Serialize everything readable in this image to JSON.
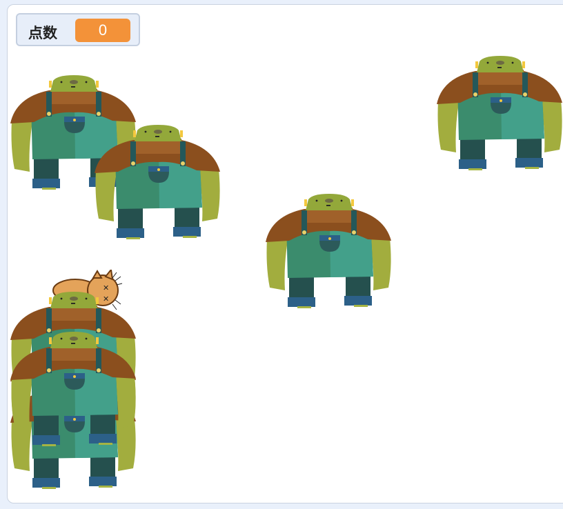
{
  "score": {
    "label": "点数",
    "value": "0"
  },
  "colors": {
    "stage_bg": "#ffffff",
    "score_value_bg": "#f39239",
    "ogre_skin": "#93a83a",
    "ogre_overalls": "#3b8c6d",
    "ogre_shoulder": "#8b4f1e",
    "cat_orange": "#e4a35a"
  },
  "sprites": {
    "ogres": [
      {
        "name": "ogre"
      },
      {
        "name": "ogre"
      },
      {
        "name": "ogre"
      },
      {
        "name": "ogre"
      },
      {
        "name": "ogre"
      },
      {
        "name": "ogre"
      },
      {
        "name": "ogre"
      },
      {
        "name": "ogre"
      }
    ],
    "cat": {
      "name": "cat",
      "state": "dizzy"
    }
  }
}
